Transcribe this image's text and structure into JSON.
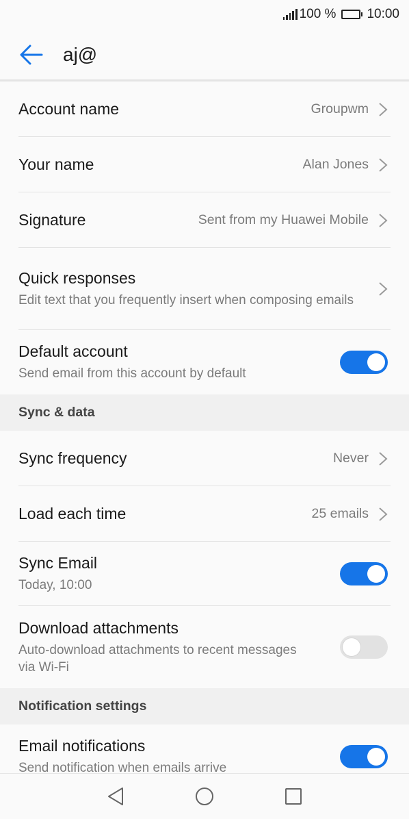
{
  "status_bar": {
    "battery_text": "100 %",
    "time": "10:00"
  },
  "app_bar": {
    "title": "aj@"
  },
  "account": {
    "account_name": {
      "label": "Account name",
      "value": "Groupwm"
    },
    "your_name": {
      "label": "Your name",
      "value": "Alan Jones"
    },
    "signature": {
      "label": "Signature",
      "value": "Sent from my Huawei Mobile"
    },
    "quick_responses": {
      "label": "Quick responses",
      "sub": "Edit text that you frequently insert when composing emails"
    },
    "default_account": {
      "label": "Default account",
      "sub": "Send email from this account by default",
      "enabled": true
    }
  },
  "sync": {
    "header": "Sync & data",
    "sync_frequency": {
      "label": "Sync frequency",
      "value": "Never"
    },
    "load_each_time": {
      "label": "Load each time",
      "value": "25 emails"
    },
    "sync_email": {
      "label": "Sync Email",
      "sub": "Today, 10:00",
      "enabled": true
    },
    "download_attachments": {
      "label": "Download attachments",
      "sub": "Auto-download attachments to recent messages via Wi-Fi",
      "enabled": false
    }
  },
  "notifications": {
    "header": "Notification settings",
    "email_notifications": {
      "label": "Email notifications",
      "sub": "Send notification when emails arrive",
      "enabled": true
    }
  },
  "colors": {
    "accent": "#1675e8",
    "toggle_off": "#e2e2e2",
    "secondary_text": "#7b7b7b"
  },
  "icons": [
    "signal-icon",
    "battery-icon",
    "back-arrow-icon",
    "chevron-right-icon",
    "nav-back-icon",
    "nav-home-icon",
    "nav-recents-icon"
  ]
}
